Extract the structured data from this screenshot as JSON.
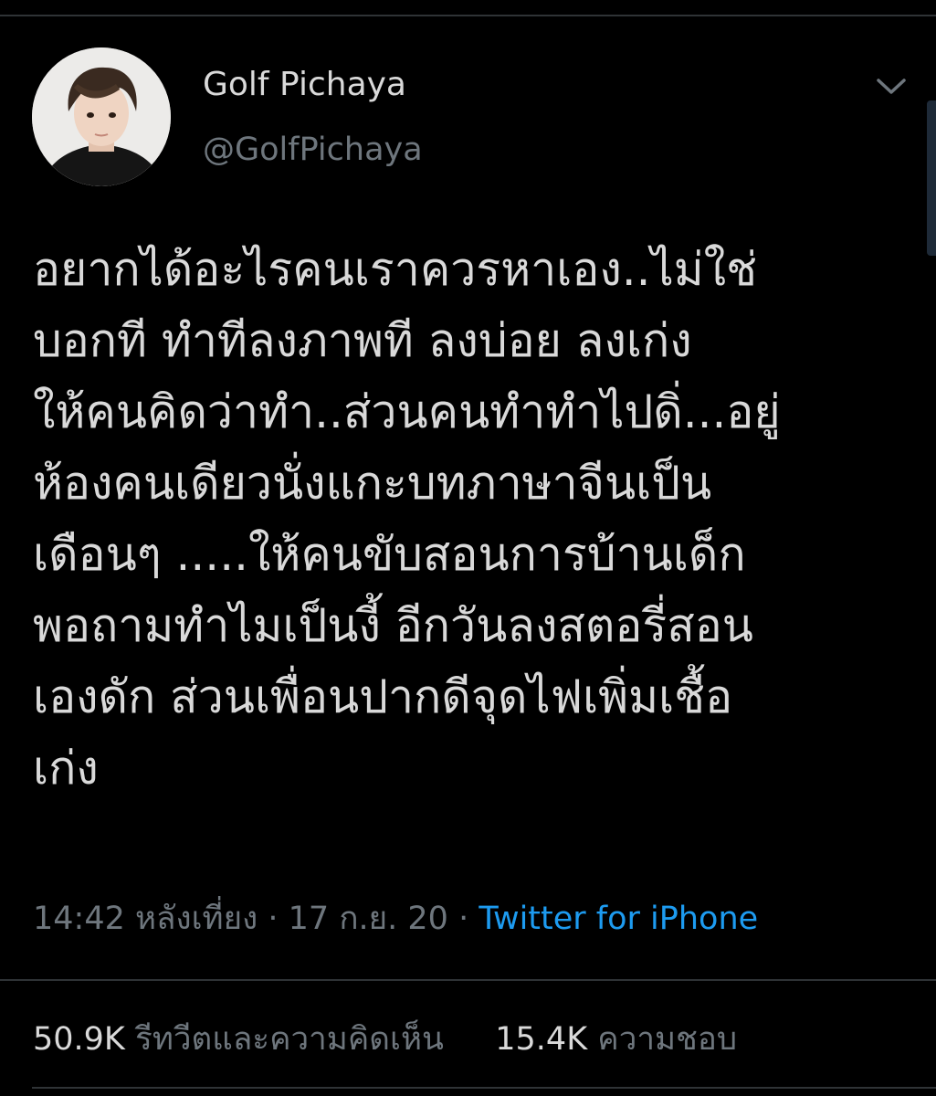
{
  "author": {
    "display_name": "Golf Pichaya",
    "handle": "@GolfPichaya",
    "avatar_icon": "profile-photo-icon",
    "more_icon": "chevron-down-icon"
  },
  "tweet": {
    "lines": [
      "อยากได้อะไรคนเราควรหาเอง..ไม่ใช่",
      "บอกที ทำทีลงภาพที ลงบ่อย ลงเก่ง",
      "ให้คนคิดว่าทำ..ส่วนคนทำทำไปดิ่...อยู่",
      "ห้องคนเดียวนั่งแกะบทภาษาจีนเป็น",
      "เดือนๆ .....ให้คนขับสอนการบ้านเด็ก",
      "พอถามทำไมเป็นงี้ อีกวันลงสตอรี่สอน",
      "เองดัก ส่วนเพื่อนปากดีจุดไฟเพิ่มเชื้อ",
      "เก่ง"
    ],
    "time": "14:42 หลังเที่ยง",
    "separator": "·",
    "date": "17 ก.ย. 20",
    "source": "Twitter for iPhone"
  },
  "stats": {
    "retweets_count": "50.9K",
    "retweets_label": "รีทวีตและความคิดเห็น",
    "likes_count": "15.4K",
    "likes_label": "ความชอบ"
  },
  "colors": {
    "background": "#000000",
    "text_primary": "#d9d9d9",
    "text_secondary": "#6e767d",
    "link": "#1d9bf0",
    "divider": "#2f3336"
  }
}
